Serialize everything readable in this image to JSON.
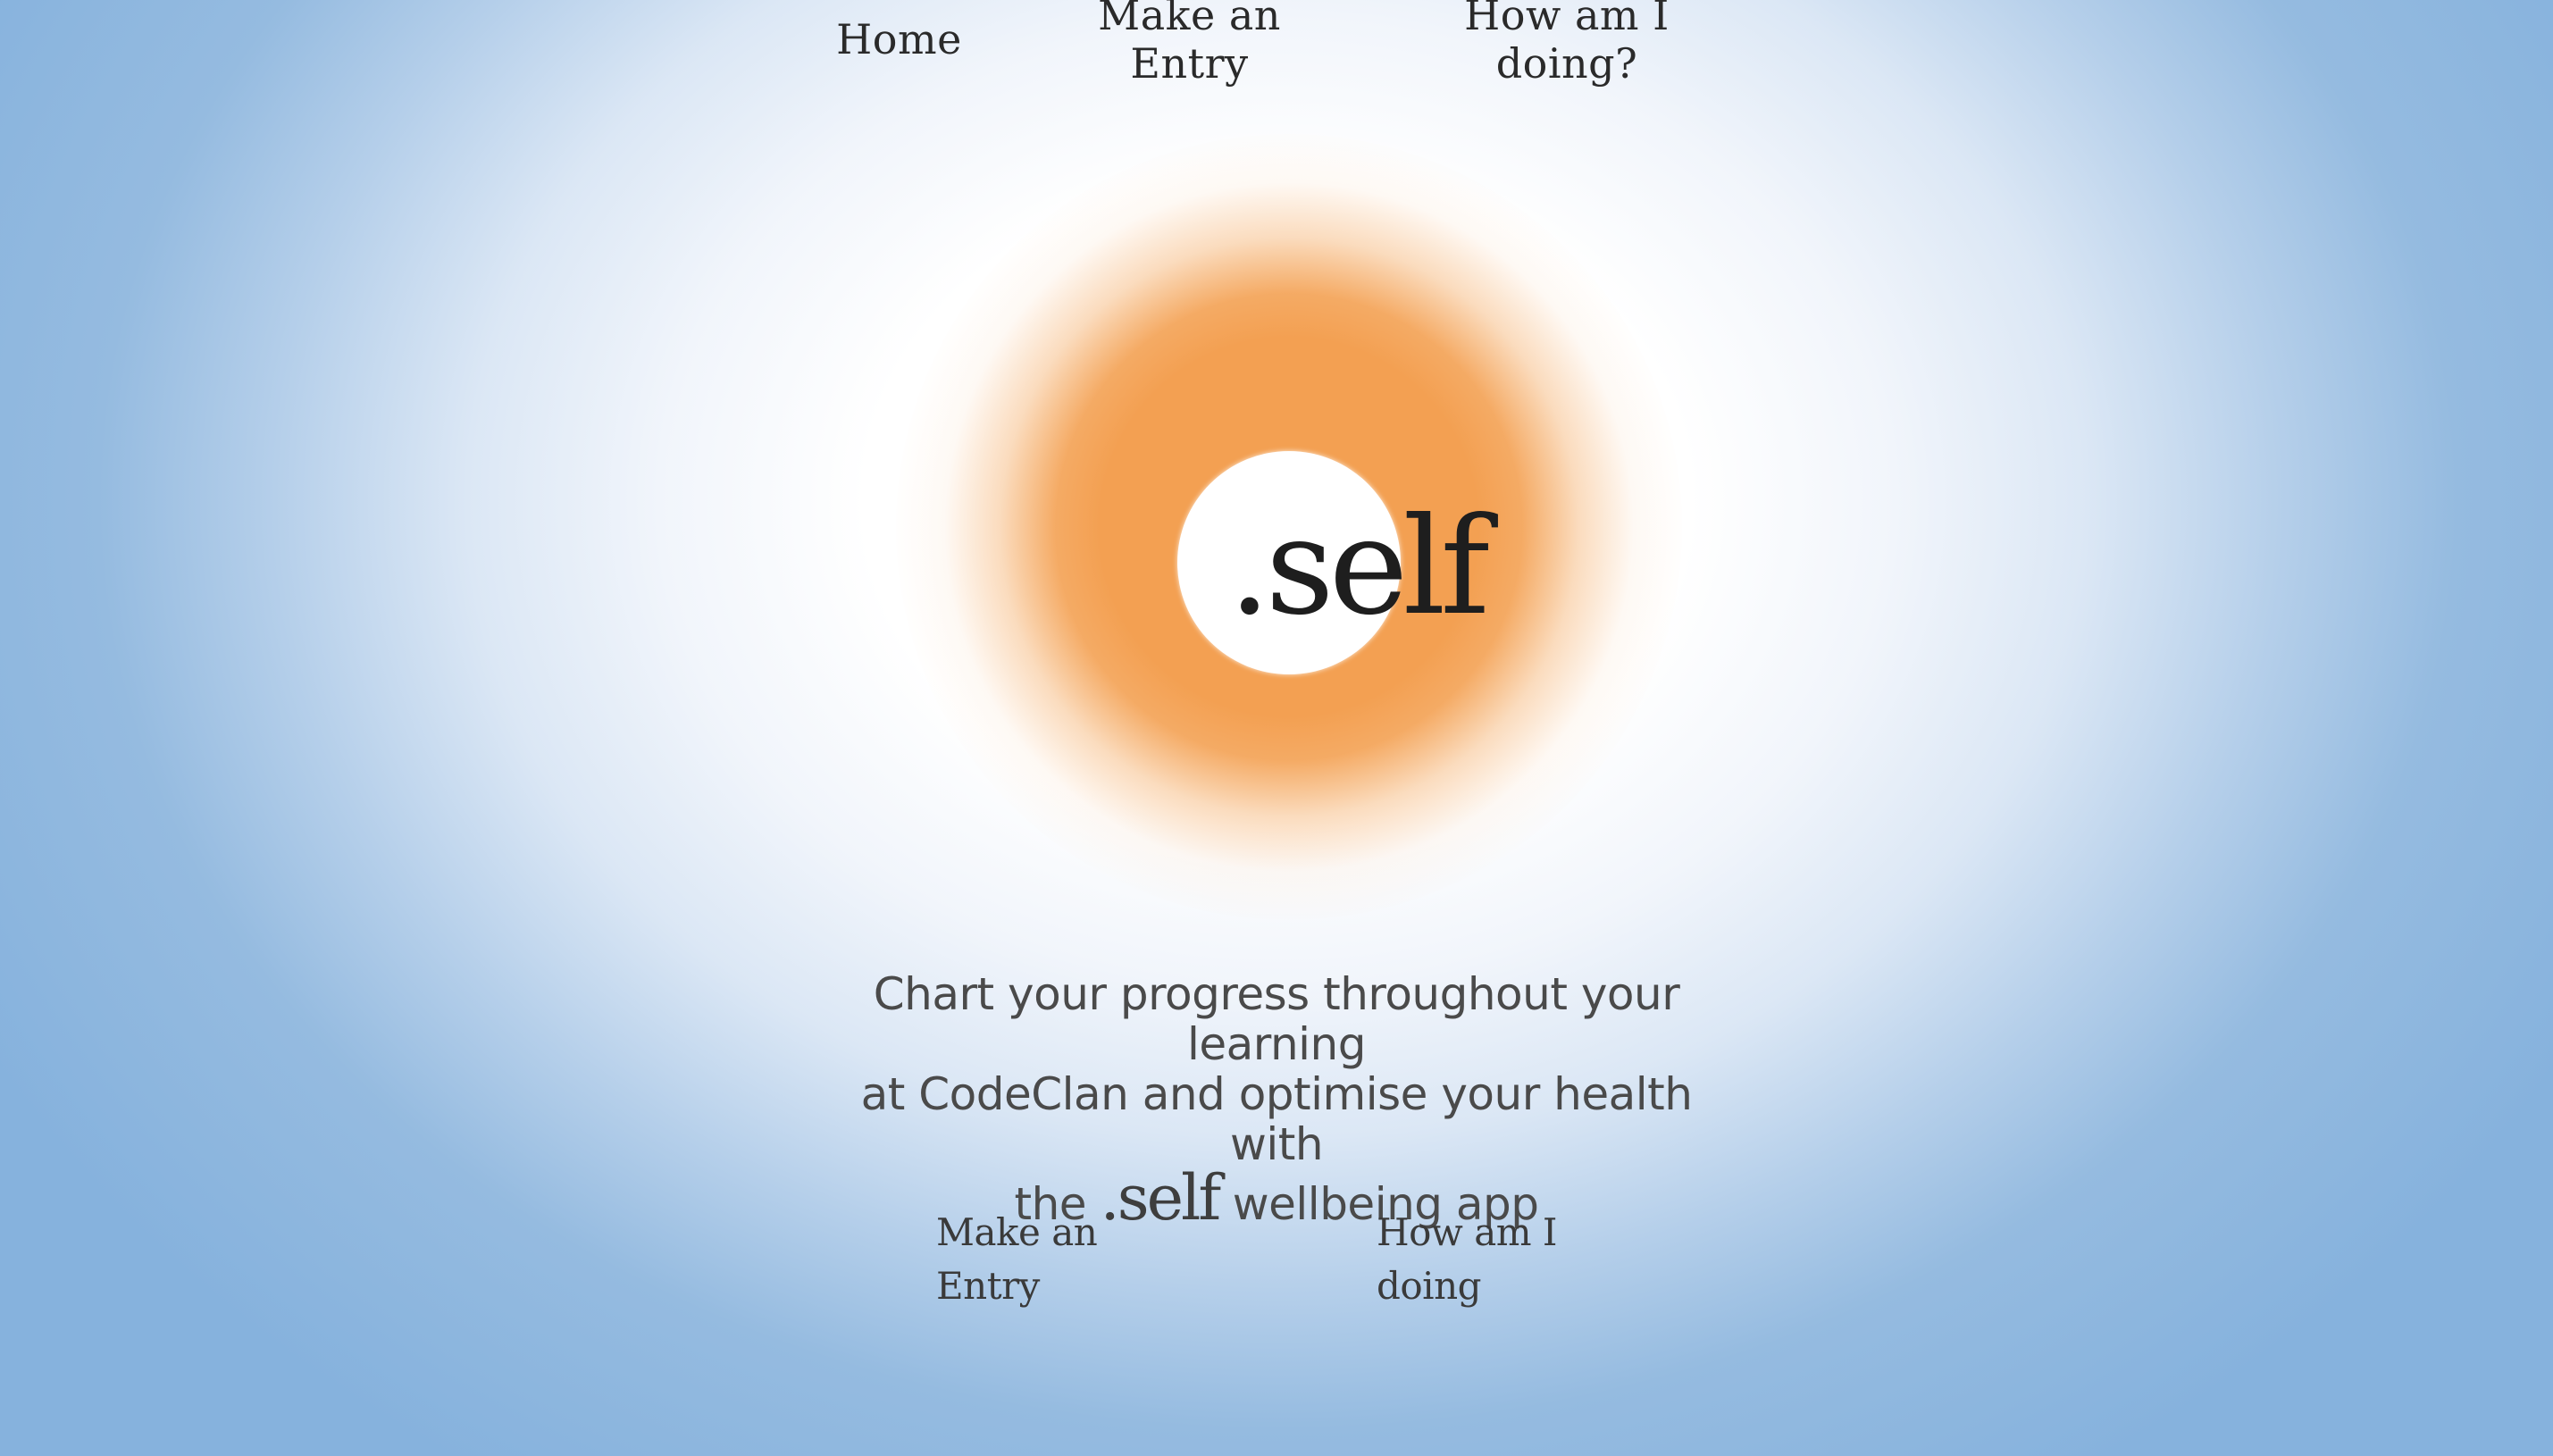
{
  "nav": {
    "home": "Home",
    "make_entry": "Make an Entry",
    "how_doing": "How am I doing?"
  },
  "hero": {
    "logo": ".self"
  },
  "tagline": {
    "line1": "Chart your progress throughout your learning",
    "line2": "at CodeClan and optimise your health with",
    "line3_prefix": "the",
    "line3_brand": ".self",
    "line3_suffix": "wellbeing app"
  },
  "actions": {
    "make_entry": "Make an Entry",
    "how_doing": "How am I doing"
  },
  "colors": {
    "glow": "#f3a052",
    "sky": "#86b2dd",
    "text": "#2b2b2b"
  }
}
